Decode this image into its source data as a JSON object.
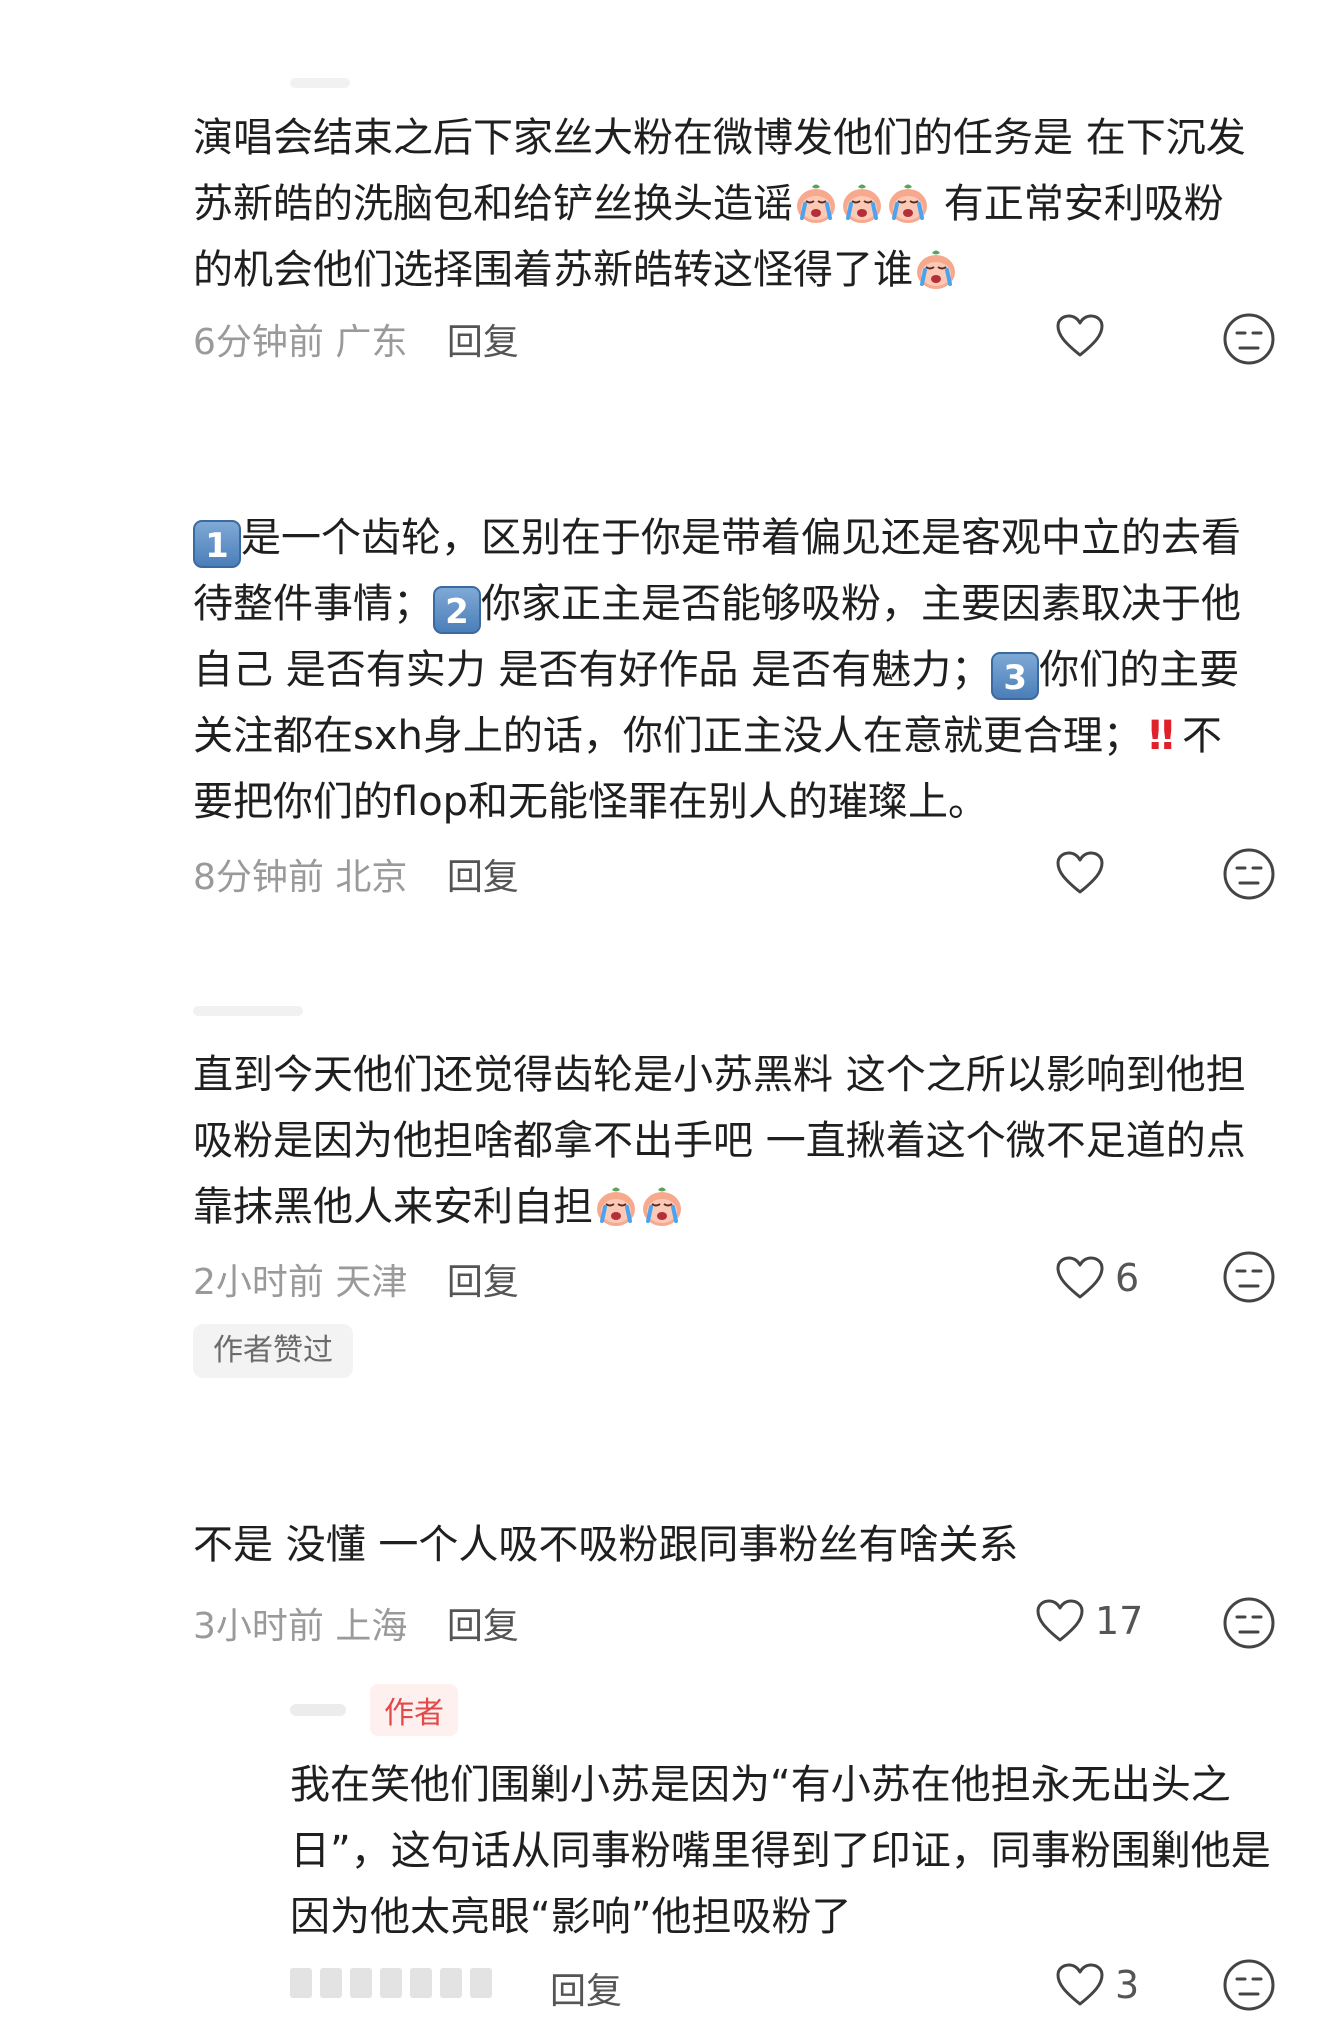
{
  "comments": [
    {
      "text_parts": [
        "演唱会结束之后下家丝大粉在微博发他们的任务是 在下沉发苏新皓的洗脑包和给铲丝换头造谣",
        " 有正常安利吸粉的机会他们选择围着苏新皓转这怪得了谁"
      ],
      "time": "6分钟前",
      "location": "广东",
      "reply_label": "回复",
      "likes": ""
    },
    {
      "text_parts": [
        "是一个齿轮，区别在于你是带着偏见还是客观中立的去看待整件事情；",
        "你家正主是否能够吸粉，主要因素取决于他自己 是否有实力 是否有好作品 是否有魅力；",
        "你们的主要关注都在sxh身上的话，你们正主没人在意就更合理；",
        "不要把你们的flop和无能怪罪在别人的璀璨上。"
      ],
      "keycaps": [
        "1",
        "2",
        "3"
      ],
      "bangs": "‼",
      "time": "8分钟前",
      "location": "北京",
      "reply_label": "回复",
      "likes": ""
    },
    {
      "text_parts": [
        "直到今天他们还觉得齿轮是小苏黑料  这个之所以影响到他担吸粉是因为他担啥都拿不出手吧 一直揪着这个微不足道的点 靠抹黑他人来安利自担"
      ],
      "time": "2小时前",
      "location": "天津",
      "reply_label": "回复",
      "likes": "6",
      "tag": "作者赞过"
    },
    {
      "text_parts": [
        "不是  没懂  一个人吸不吸粉跟同事粉丝有啥关系"
      ],
      "time": "3小时前",
      "location": "上海",
      "reply_label": "回复",
      "likes": "17"
    }
  ],
  "sub_reply": {
    "badge": "作者",
    "text": "我在笑他们围剿小苏是因为“有小苏在他担永无出头之日”，这句话从同事粉嘴里得到了印证，同事粉围剿他是因为他太亮眼“影响”他担吸粉了",
    "reply_label": "回复",
    "likes": "3"
  },
  "colors": {
    "text": "#1f1f1f",
    "meta": "#9a9a9a",
    "author_badge": "#e04a4a",
    "keycap": "#4b7fb9"
  },
  "icons": [
    "heart-icon",
    "neutral-face-icon",
    "crying-face-emoji",
    "keycap-emoji",
    "double-exclamation-emoji"
  ]
}
